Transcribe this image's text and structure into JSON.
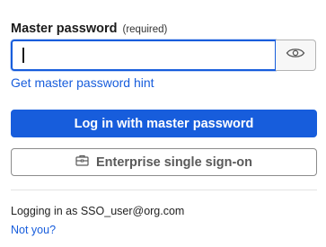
{
  "password_field": {
    "label": "Master password",
    "required_note": "(required)",
    "value": "",
    "eye_icon": "eye-icon"
  },
  "hint_link": "Get master password hint",
  "primary_button": {
    "label": "Log in with master password"
  },
  "sso_button": {
    "label": "Enterprise single sign-on",
    "icon": "briefcase-icon"
  },
  "footer": {
    "logging_in_text": "Logging in as SSO_user@org.com",
    "not_you_link": "Not you?"
  },
  "colors": {
    "primary": "#175ddc",
    "text": "#1b1b1b",
    "secondary_text": "#5a5a5a"
  }
}
